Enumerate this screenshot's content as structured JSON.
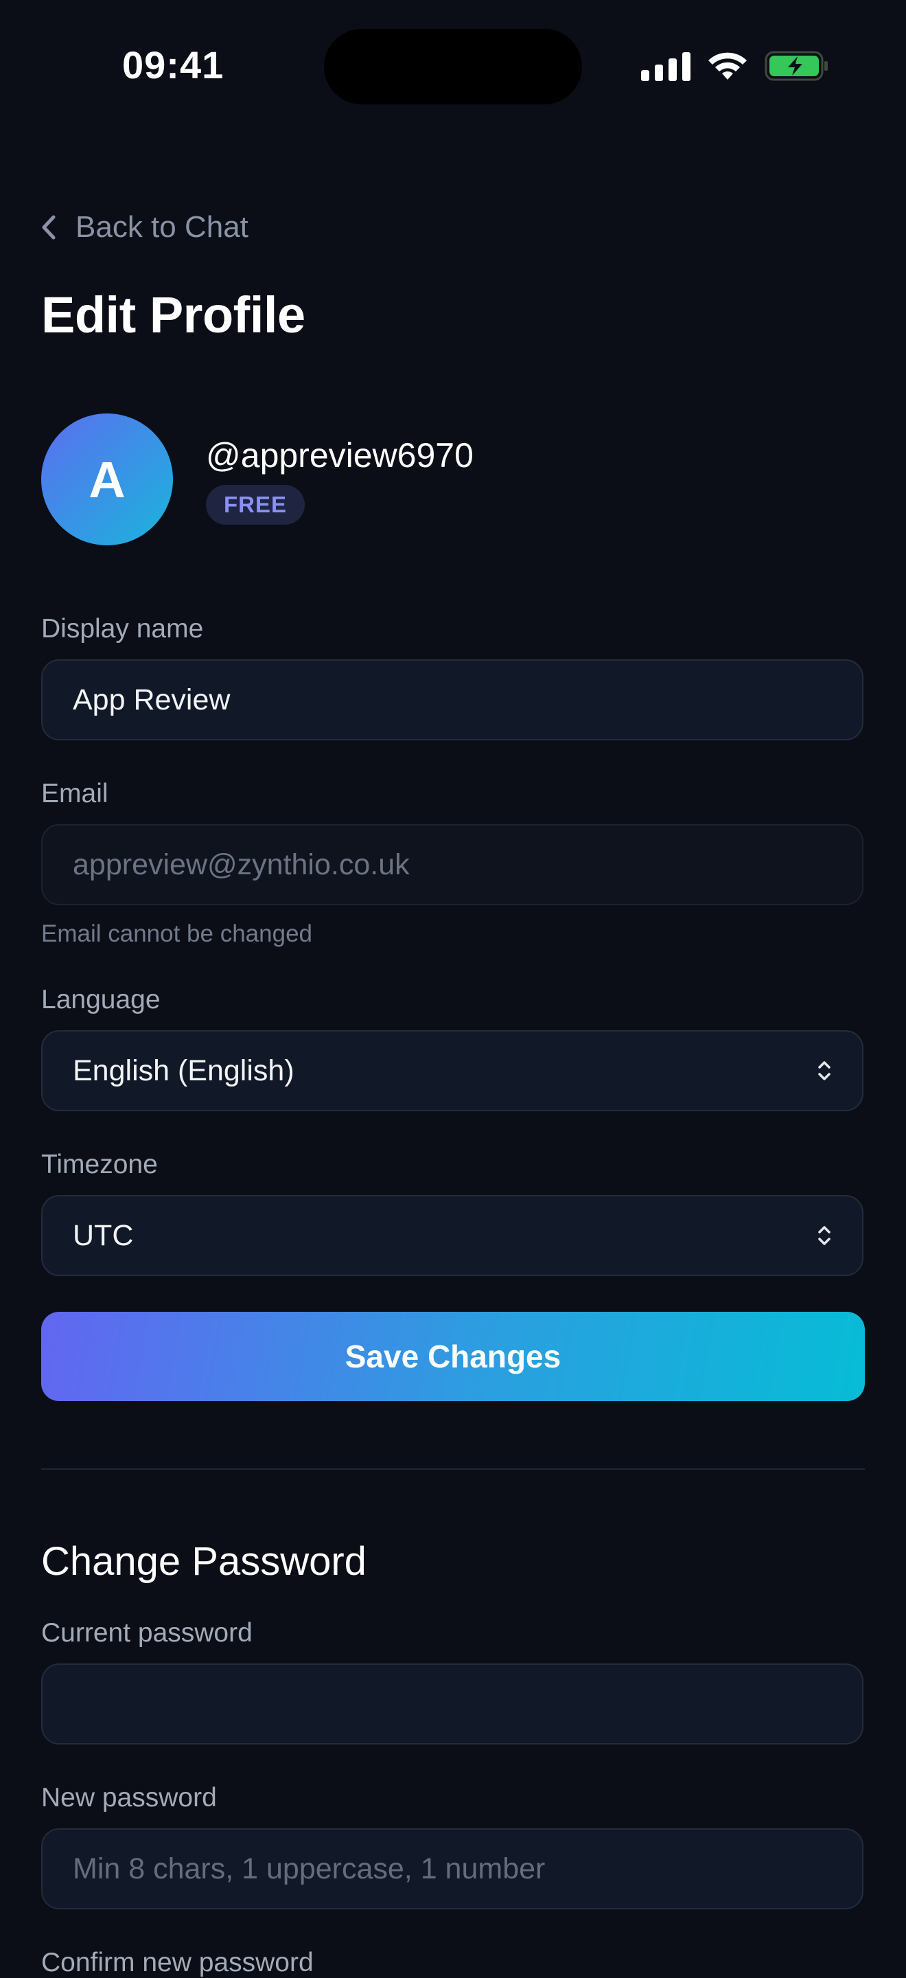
{
  "status_bar": {
    "time": "09:41",
    "icons": [
      "signal-icon",
      "wifi-icon",
      "battery-charging-icon"
    ],
    "battery_color": "#34c759"
  },
  "nav": {
    "back_label": "Back to Chat",
    "back_icon": "chevron-left-icon"
  },
  "page": {
    "title": "Edit Profile"
  },
  "profile": {
    "avatar_initial": "A",
    "username": "@appreview6970",
    "plan_badge": "FREE"
  },
  "form": {
    "display_name_label": "Display name",
    "display_name_value": "App Review",
    "email_label": "Email",
    "email_value": "appreview@zynthio.co.uk",
    "email_hint": "Email cannot be changed",
    "language_label": "Language",
    "language_value": "English (English)",
    "timezone_label": "Timezone",
    "timezone_value": "UTC",
    "save_label": "Save Changes"
  },
  "password": {
    "section_title": "Change Password",
    "current_label": "Current password",
    "current_placeholder": "",
    "new_label": "New password",
    "new_placeholder": "Min 8 chars, 1 uppercase, 1 number",
    "confirm_label": "Confirm new password"
  },
  "colors": {
    "background": "#0b0e16",
    "field_background": "#111827",
    "accent_start": "#6366f1",
    "accent_end": "#07bcd6",
    "badge_text": "#8b90f5"
  }
}
